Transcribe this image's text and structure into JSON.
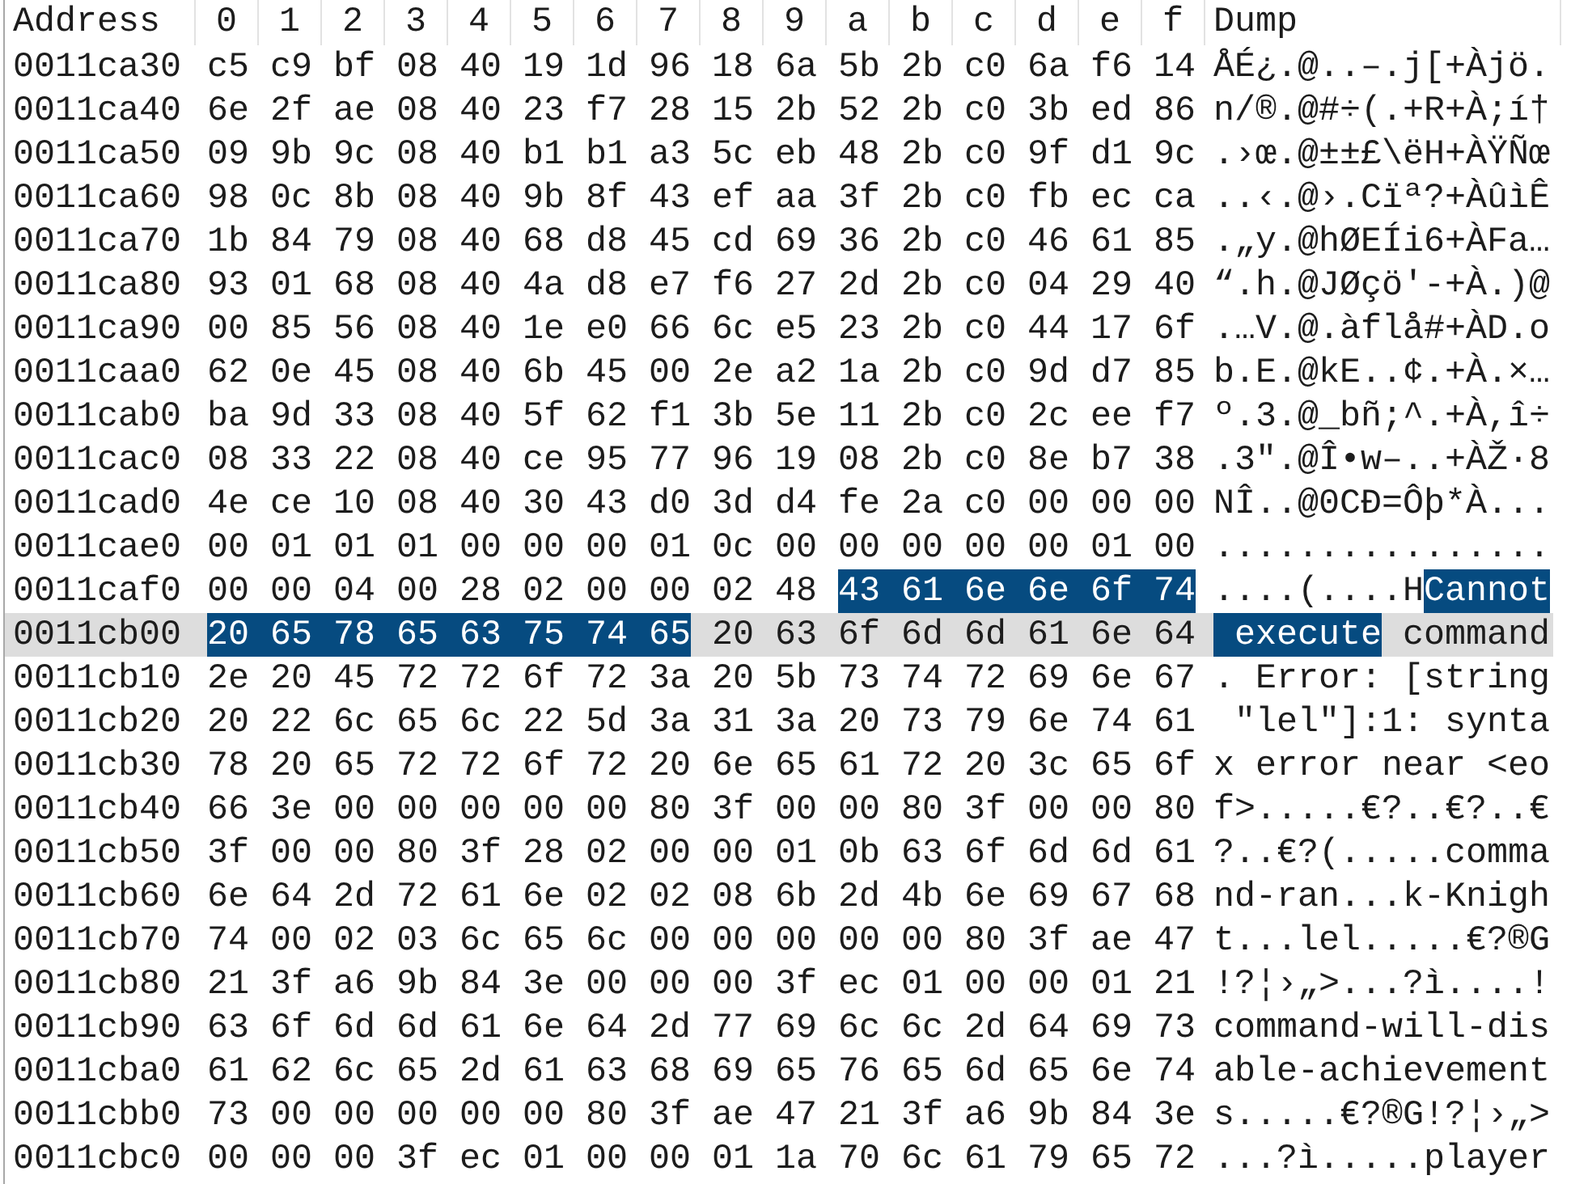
{
  "header": {
    "address": "Address",
    "offsets": [
      "0",
      "1",
      "2",
      "3",
      "4",
      "5",
      "6",
      "7",
      "8",
      "9",
      "a",
      "b",
      "c",
      "d",
      "e",
      "f"
    ],
    "dump": "Dump"
  },
  "rows": [
    {
      "address": "0011ca30",
      "current": false,
      "hex": [
        {
          "bytes": [
            "c5",
            "c9",
            "bf",
            "08",
            "40",
            "19",
            "1d",
            "96",
            "18",
            "6a",
            "5b",
            "2b",
            "c0",
            "6a",
            "f6",
            "14"
          ],
          "selected": false
        }
      ],
      "dump": [
        {
          "text": "ÅÉ¿.@..–.j[+Àjö.",
          "selected": false
        }
      ]
    },
    {
      "address": "0011ca40",
      "current": false,
      "hex": [
        {
          "bytes": [
            "6e",
            "2f",
            "ae",
            "08",
            "40",
            "23",
            "f7",
            "28",
            "15",
            "2b",
            "52",
            "2b",
            "c0",
            "3b",
            "ed",
            "86"
          ],
          "selected": false
        }
      ],
      "dump": [
        {
          "text": "n/®.@#÷(.+R+À;í†",
          "selected": false
        }
      ]
    },
    {
      "address": "0011ca50",
      "current": false,
      "hex": [
        {
          "bytes": [
            "09",
            "9b",
            "9c",
            "08",
            "40",
            "b1",
            "b1",
            "a3",
            "5c",
            "eb",
            "48",
            "2b",
            "c0",
            "9f",
            "d1",
            "9c"
          ],
          "selected": false
        }
      ],
      "dump": [
        {
          "text": ".›œ.@±±£\\ëH+ÀŸÑœ",
          "selected": false
        }
      ]
    },
    {
      "address": "0011ca60",
      "current": false,
      "hex": [
        {
          "bytes": [
            "98",
            "0c",
            "8b",
            "08",
            "40",
            "9b",
            "8f",
            "43",
            "ef",
            "aa",
            "3f",
            "2b",
            "c0",
            "fb",
            "ec",
            "ca"
          ],
          "selected": false
        }
      ],
      "dump": [
        {
          "text": "..‹.@›.Cïª?+ÀûìÊ",
          "selected": false
        }
      ]
    },
    {
      "address": "0011ca70",
      "current": false,
      "hex": [
        {
          "bytes": [
            "1b",
            "84",
            "79",
            "08",
            "40",
            "68",
            "d8",
            "45",
            "cd",
            "69",
            "36",
            "2b",
            "c0",
            "46",
            "61",
            "85"
          ],
          "selected": false
        }
      ],
      "dump": [
        {
          "text": ".„y.@hØEÍi6+ÀFa…",
          "selected": false
        }
      ]
    },
    {
      "address": "0011ca80",
      "current": false,
      "hex": [
        {
          "bytes": [
            "93",
            "01",
            "68",
            "08",
            "40",
            "4a",
            "d8",
            "e7",
            "f6",
            "27",
            "2d",
            "2b",
            "c0",
            "04",
            "29",
            "40"
          ],
          "selected": false
        }
      ],
      "dump": [
        {
          "text": "“.h.@JØçö'-+À.)@",
          "selected": false
        }
      ]
    },
    {
      "address": "0011ca90",
      "current": false,
      "hex": [
        {
          "bytes": [
            "00",
            "85",
            "56",
            "08",
            "40",
            "1e",
            "e0",
            "66",
            "6c",
            "e5",
            "23",
            "2b",
            "c0",
            "44",
            "17",
            "6f"
          ],
          "selected": false
        }
      ],
      "dump": [
        {
          "text": ".…V.@.àflå#+ÀD.o",
          "selected": false
        }
      ]
    },
    {
      "address": "0011caa0",
      "current": false,
      "hex": [
        {
          "bytes": [
            "62",
            "0e",
            "45",
            "08",
            "40",
            "6b",
            "45",
            "00",
            "2e",
            "a2",
            "1a",
            "2b",
            "c0",
            "9d",
            "d7",
            "85"
          ],
          "selected": false
        }
      ],
      "dump": [
        {
          "text": "b.E.@kE..¢.+À.×…",
          "selected": false
        }
      ]
    },
    {
      "address": "0011cab0",
      "current": false,
      "hex": [
        {
          "bytes": [
            "ba",
            "9d",
            "33",
            "08",
            "40",
            "5f",
            "62",
            "f1",
            "3b",
            "5e",
            "11",
            "2b",
            "c0",
            "2c",
            "ee",
            "f7"
          ],
          "selected": false
        }
      ],
      "dump": [
        {
          "text": "º.3.@_bñ;^.+À,î÷",
          "selected": false
        }
      ]
    },
    {
      "address": "0011cac0",
      "current": false,
      "hex": [
        {
          "bytes": [
            "08",
            "33",
            "22",
            "08",
            "40",
            "ce",
            "95",
            "77",
            "96",
            "19",
            "08",
            "2b",
            "c0",
            "8e",
            "b7",
            "38"
          ],
          "selected": false
        }
      ],
      "dump": [
        {
          "text": ".3\".@Î•w–..+ÀŽ·8",
          "selected": false
        }
      ]
    },
    {
      "address": "0011cad0",
      "current": false,
      "hex": [
        {
          "bytes": [
            "4e",
            "ce",
            "10",
            "08",
            "40",
            "30",
            "43",
            "d0",
            "3d",
            "d4",
            "fe",
            "2a",
            "c0",
            "00",
            "00",
            "00"
          ],
          "selected": false
        }
      ],
      "dump": [
        {
          "text": "NÎ..@0CÐ=Ôþ*À...",
          "selected": false
        }
      ]
    },
    {
      "address": "0011cae0",
      "current": false,
      "hex": [
        {
          "bytes": [
            "00",
            "01",
            "01",
            "01",
            "00",
            "00",
            "00",
            "01",
            "0c",
            "00",
            "00",
            "00",
            "00",
            "00",
            "01",
            "00"
          ],
          "selected": false
        }
      ],
      "dump": [
        {
          "text": "................",
          "selected": false
        }
      ]
    },
    {
      "address": "0011caf0",
      "current": false,
      "hex": [
        {
          "bytes": [
            "00",
            "00",
            "04",
            "00",
            "28",
            "02",
            "00",
            "00",
            "02",
            "48"
          ],
          "selected": false
        },
        {
          "bytes": [
            "43",
            "61",
            "6e",
            "6e",
            "6f",
            "74"
          ],
          "selected": true
        }
      ],
      "dump": [
        {
          "text": "....(....H",
          "selected": false
        },
        {
          "text": "Cannot",
          "selected": true
        }
      ]
    },
    {
      "address": "0011cb00",
      "current": true,
      "hex": [
        {
          "bytes": [
            "20",
            "65",
            "78",
            "65",
            "63",
            "75",
            "74",
            "65"
          ],
          "selected": true
        },
        {
          "bytes": [
            "20",
            "63",
            "6f",
            "6d",
            "6d",
            "61",
            "6e",
            "64"
          ],
          "selected": false
        }
      ],
      "dump": [
        {
          "text": " execute",
          "selected": true
        },
        {
          "text": " command",
          "selected": false
        }
      ]
    },
    {
      "address": "0011cb10",
      "current": false,
      "hex": [
        {
          "bytes": [
            "2e",
            "20",
            "45",
            "72",
            "72",
            "6f",
            "72",
            "3a",
            "20",
            "5b",
            "73",
            "74",
            "72",
            "69",
            "6e",
            "67"
          ],
          "selected": false
        }
      ],
      "dump": [
        {
          "text": ". Error: [string",
          "selected": false
        }
      ]
    },
    {
      "address": "0011cb20",
      "current": false,
      "hex": [
        {
          "bytes": [
            "20",
            "22",
            "6c",
            "65",
            "6c",
            "22",
            "5d",
            "3a",
            "31",
            "3a",
            "20",
            "73",
            "79",
            "6e",
            "74",
            "61"
          ],
          "selected": false
        }
      ],
      "dump": [
        {
          "text": " \"lel\"]:1: synta",
          "selected": false
        }
      ]
    },
    {
      "address": "0011cb30",
      "current": false,
      "hex": [
        {
          "bytes": [
            "78",
            "20",
            "65",
            "72",
            "72",
            "6f",
            "72",
            "20",
            "6e",
            "65",
            "61",
            "72",
            "20",
            "3c",
            "65",
            "6f"
          ],
          "selected": false
        }
      ],
      "dump": [
        {
          "text": "x error near <eo",
          "selected": false
        }
      ]
    },
    {
      "address": "0011cb40",
      "current": false,
      "hex": [
        {
          "bytes": [
            "66",
            "3e",
            "00",
            "00",
            "00",
            "00",
            "00",
            "80",
            "3f",
            "00",
            "00",
            "80",
            "3f",
            "00",
            "00",
            "80"
          ],
          "selected": false
        }
      ],
      "dump": [
        {
          "text": "f>.....€?..€?..€",
          "selected": false
        }
      ]
    },
    {
      "address": "0011cb50",
      "current": false,
      "hex": [
        {
          "bytes": [
            "3f",
            "00",
            "00",
            "80",
            "3f",
            "28",
            "02",
            "00",
            "00",
            "01",
            "0b",
            "63",
            "6f",
            "6d",
            "6d",
            "61"
          ],
          "selected": false
        }
      ],
      "dump": [
        {
          "text": "?..€?(.....comma",
          "selected": false
        }
      ]
    },
    {
      "address": "0011cb60",
      "current": false,
      "hex": [
        {
          "bytes": [
            "6e",
            "64",
            "2d",
            "72",
            "61",
            "6e",
            "02",
            "02",
            "08",
            "6b",
            "2d",
            "4b",
            "6e",
            "69",
            "67",
            "68"
          ],
          "selected": false
        }
      ],
      "dump": [
        {
          "text": "nd-ran...k-Knigh",
          "selected": false
        }
      ]
    },
    {
      "address": "0011cb70",
      "current": false,
      "hex": [
        {
          "bytes": [
            "74",
            "00",
            "02",
            "03",
            "6c",
            "65",
            "6c",
            "00",
            "00",
            "00",
            "00",
            "00",
            "80",
            "3f",
            "ae",
            "47"
          ],
          "selected": false
        }
      ],
      "dump": [
        {
          "text": "t...lel.....€?®G",
          "selected": false
        }
      ]
    },
    {
      "address": "0011cb80",
      "current": false,
      "hex": [
        {
          "bytes": [
            "21",
            "3f",
            "a6",
            "9b",
            "84",
            "3e",
            "00",
            "00",
            "00",
            "3f",
            "ec",
            "01",
            "00",
            "00",
            "01",
            "21"
          ],
          "selected": false
        }
      ],
      "dump": [
        {
          "text": "!?¦›„>...?ì....!",
          "selected": false
        }
      ]
    },
    {
      "address": "0011cb90",
      "current": false,
      "hex": [
        {
          "bytes": [
            "63",
            "6f",
            "6d",
            "6d",
            "61",
            "6e",
            "64",
            "2d",
            "77",
            "69",
            "6c",
            "6c",
            "2d",
            "64",
            "69",
            "73"
          ],
          "selected": false
        }
      ],
      "dump": [
        {
          "text": "command-will-dis",
          "selected": false
        }
      ]
    },
    {
      "address": "0011cba0",
      "current": false,
      "hex": [
        {
          "bytes": [
            "61",
            "62",
            "6c",
            "65",
            "2d",
            "61",
            "63",
            "68",
            "69",
            "65",
            "76",
            "65",
            "6d",
            "65",
            "6e",
            "74"
          ],
          "selected": false
        }
      ],
      "dump": [
        {
          "text": "able-achievement",
          "selected": false
        }
      ]
    },
    {
      "address": "0011cbb0",
      "current": false,
      "hex": [
        {
          "bytes": [
            "73",
            "00",
            "00",
            "00",
            "00",
            "00",
            "80",
            "3f",
            "ae",
            "47",
            "21",
            "3f",
            "a6",
            "9b",
            "84",
            "3e"
          ],
          "selected": false
        }
      ],
      "dump": [
        {
          "text": "s.....€?®G!?¦›„>",
          "selected": false
        }
      ]
    },
    {
      "address": "0011cbc0",
      "current": false,
      "hex": [
        {
          "bytes": [
            "00",
            "00",
            "00",
            "3f",
            "ec",
            "01",
            "00",
            "00",
            "01",
            "1a",
            "70",
            "6c",
            "61",
            "79",
            "65",
            "72"
          ],
          "selected": false
        }
      ],
      "dump": [
        {
          "text": "...?ì.....player",
          "selected": false
        }
      ]
    }
  ]
}
